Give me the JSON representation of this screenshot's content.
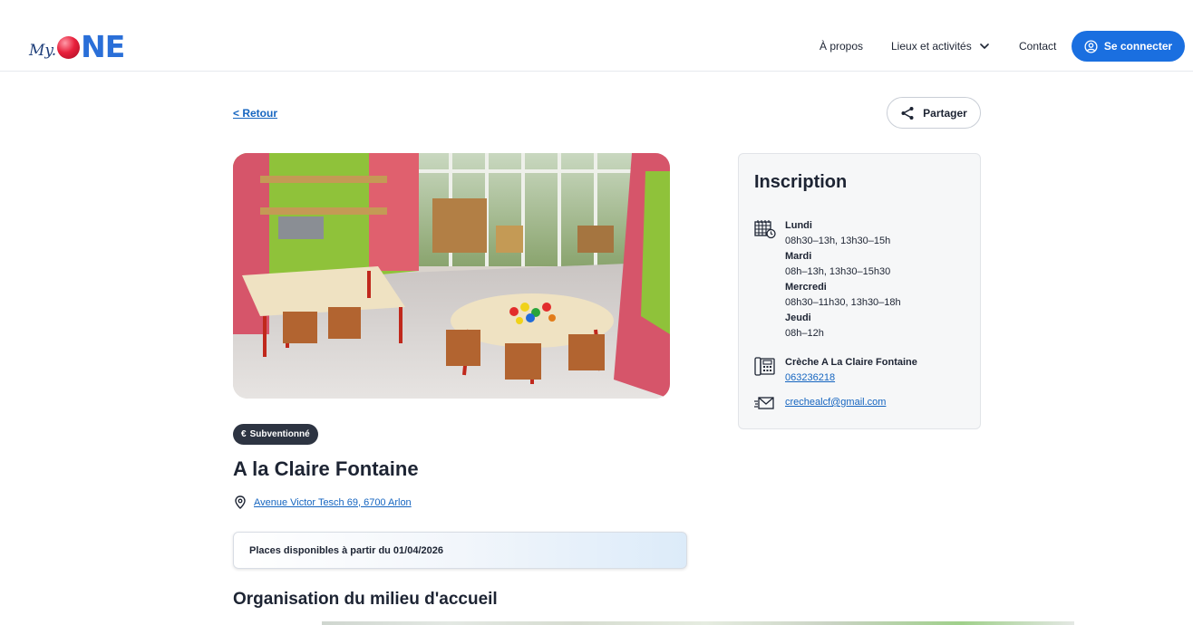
{
  "header": {
    "logo": {
      "prefix": "My.",
      "suffix": "NE"
    },
    "nav": {
      "about": "À propos",
      "places_activities": "Lieux et activités",
      "contact": "Contact"
    },
    "login_label": "Se connecter"
  },
  "page": {
    "back_label": "< Retour",
    "share_label": "Partager",
    "badge_label": "Subventionné",
    "title": "A la Claire Fontaine",
    "address": "Avenue Victor Tesch 69, 6700 Arlon",
    "availability": "Places disponibles à partir du 01/04/2026",
    "section_title": "Organisation du milieu d'accueil"
  },
  "inscription": {
    "title": "Inscription",
    "schedule": [
      {
        "day": "Lundi",
        "hours": "08h30–13h, 13h30–15h"
      },
      {
        "day": "Mardi",
        "hours": "08h–13h, 13h30–15h30"
      },
      {
        "day": "Mercredi",
        "hours": "08h30–11h30, 13h30–18h"
      },
      {
        "day": "Jeudi",
        "hours": "08h–12h"
      }
    ],
    "contact_name": "Crèche A La Claire Fontaine",
    "phone": "063236218",
    "email": "crechealcf@gmail.com"
  },
  "colors": {
    "primary": "#1a6fe0",
    "link": "#1565c0",
    "badge_bg": "#2d3442",
    "text": "#1d2433"
  }
}
